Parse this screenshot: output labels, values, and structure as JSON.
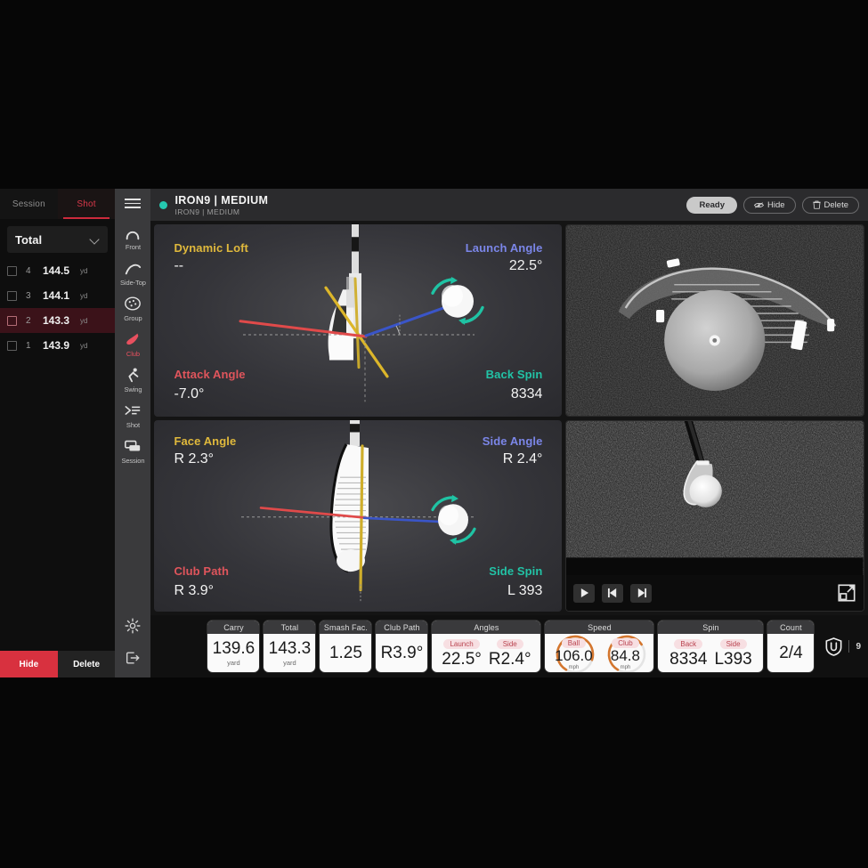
{
  "shot_panel": {
    "tabs": [
      {
        "label": "Session",
        "active": false
      },
      {
        "label": "Shot",
        "active": true
      }
    ],
    "metric_select": {
      "value": "Total",
      "icon": "chevron-down-icon"
    },
    "shots": [
      {
        "index": "4",
        "value": "144.5",
        "unit": "yd",
        "selected": false
      },
      {
        "index": "3",
        "value": "144.1",
        "unit": "yd",
        "selected": false
      },
      {
        "index": "2",
        "value": "143.3",
        "unit": "yd",
        "selected": true
      },
      {
        "index": "1",
        "value": "143.9",
        "unit": "yd",
        "selected": false
      }
    ],
    "hide_label": "Hide",
    "delete_label": "Delete"
  },
  "rail": {
    "menu_icon": "hamburger-menu-icon",
    "items": [
      {
        "label": "Front",
        "icon": "front-view-icon",
        "active": false
      },
      {
        "label": "Side-Top",
        "icon": "side-top-view-icon",
        "active": false
      },
      {
        "label": "Group",
        "icon": "group-dispersion-icon",
        "active": false
      },
      {
        "label": "Club",
        "icon": "club-icon",
        "active": true
      },
      {
        "label": "Swing",
        "icon": "swing-icon",
        "active": false
      },
      {
        "label": "Shot",
        "icon": "shot-list-icon",
        "active": false
      },
      {
        "label": "Session",
        "icon": "session-icon",
        "active": false
      }
    ],
    "settings_icon": "gear-icon",
    "exit_icon": "logout-icon"
  },
  "header": {
    "status_dot_color": "#25c9b0",
    "title": "IRON9 | MEDIUM",
    "subtitle": "IRON9 | MEDIUM",
    "ready_label": "Ready",
    "hide_label": "Hide",
    "delete_label": "Delete",
    "hide_icon": "eye-hide-icon",
    "delete_icon": "trash-icon"
  },
  "club_view_face": {
    "top_left": {
      "label": "Dynamic Loft",
      "value": "--",
      "color": "#e0b93c"
    },
    "top_right": {
      "label": "Launch Angle",
      "value": "22.5°",
      "color": "#7b86e8"
    },
    "bottom_left": {
      "label": "Attack Angle",
      "value": "-7.0°",
      "color": "#e0555c"
    },
    "bottom_right": {
      "label": "Back Spin",
      "value": "8334",
      "color": "#22c3a6"
    }
  },
  "club_view_top": {
    "top_left": {
      "label": "Face Angle",
      "value": "R 2.3°",
      "color": "#e0b93c"
    },
    "top_right": {
      "label": "Side Angle",
      "value": "R 2.4°",
      "color": "#7b86e8"
    },
    "bottom_left": {
      "label": "Club Path",
      "value": "R 3.9°",
      "color": "#e0555c"
    },
    "bottom_right": {
      "label": "Side Spin",
      "value": "L 393",
      "color": "#22c3a6"
    }
  },
  "camera_panels": [
    {
      "name": "impact-camera-face-on",
      "caption": ""
    },
    {
      "name": "impact-camera-top-down",
      "caption": ""
    }
  ],
  "playback": {
    "play_icon": "play-icon",
    "step_back_icon": "step-backward-icon",
    "step_forward_icon": "step-forward-icon",
    "expand_icon": "expand-fullscreen-icon"
  },
  "stats": {
    "carry": {
      "title": "Carry",
      "value": "139.6",
      "unit": "yard"
    },
    "total": {
      "title": "Total",
      "value": "143.3",
      "unit": "yard"
    },
    "smash": {
      "title": "Smash Fac.",
      "value": "1.25",
      "unit": ""
    },
    "path": {
      "title": "Club Path",
      "value": "R3.9°",
      "unit": ""
    },
    "angles": {
      "title": "Angles",
      "items": [
        {
          "badge": "Launch",
          "value": "22.5°"
        },
        {
          "badge": "Side",
          "value": "R2.4°"
        }
      ]
    },
    "speed": {
      "title": "Speed",
      "items": [
        {
          "badge": "Ball",
          "value": "106.0",
          "unit": "mph",
          "arc_pct": 72
        },
        {
          "badge": "Club",
          "value": "84.8",
          "unit": "mph",
          "arc_pct": 58
        }
      ]
    },
    "spin": {
      "title": "Spin",
      "items": [
        {
          "badge": "Back",
          "value": "8334"
        },
        {
          "badge": "Side",
          "value": "L393"
        }
      ]
    },
    "count": {
      "title": "Count",
      "value": "2/4"
    },
    "brand": {
      "logo_icon": "uneekor-shield-logo",
      "number": "9"
    }
  }
}
